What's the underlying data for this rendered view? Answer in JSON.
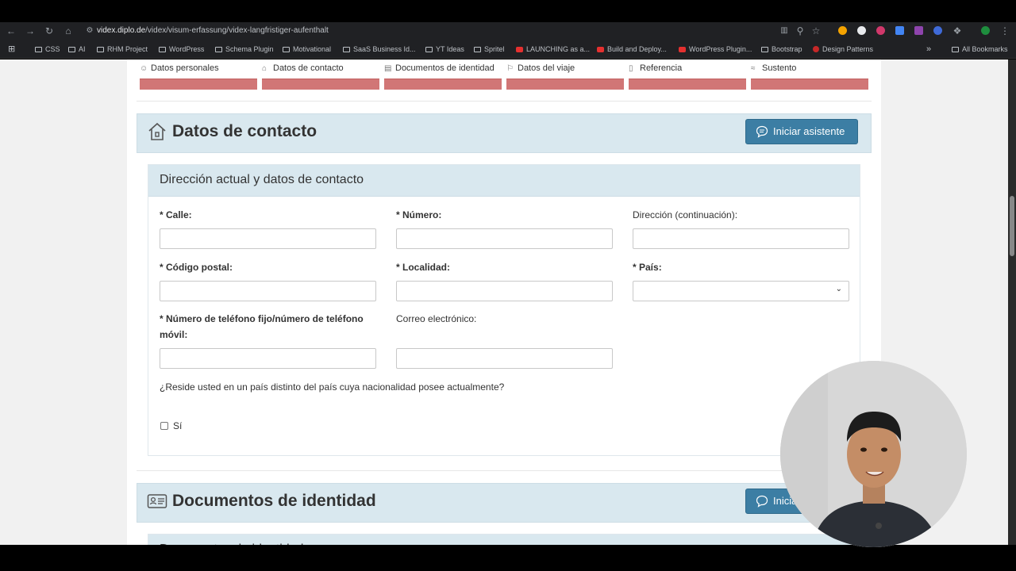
{
  "browser": {
    "url_domain": "videx.diplo.de",
    "url_path": "/videx/visum-erfassung/videx-langfristiger-aufenthalt"
  },
  "bookmarks": {
    "items": [
      "CSS",
      "AI",
      "RHM Project",
      "WordPress",
      "Schema Plugin",
      "Motivational",
      "SaaS Business Id...",
      "YT Ideas",
      "Spritel",
      "LAUNCHING as a...",
      "Build and Deploy...",
      "WordPress Plugin...",
      "Bootstrap",
      "Design Patterns"
    ],
    "more": "»",
    "all": "All Bookmarks"
  },
  "steps": [
    {
      "label": "Datos personales"
    },
    {
      "label": "Datos de contacto"
    },
    {
      "label": "Documentos de identidad"
    },
    {
      "label": "Datos del viaje"
    },
    {
      "label": "Referencia"
    },
    {
      "label": "Sustento"
    }
  ],
  "section_contact": {
    "title": "Datos de contacto",
    "assist_button": "Iniciar asistente"
  },
  "card": {
    "title": "Dirección actual y datos de contacto",
    "fields": {
      "calle": "* Calle:",
      "numero": "* Número:",
      "direccion2": "Dirección (continuación):",
      "codigo_postal": "* Código postal:",
      "localidad": "* Localidad:",
      "pais": "* País:",
      "telefono_line1": "* Número de teléfono fijo/número de teléfono",
      "telefono_line2": "móvil:",
      "correo": "Correo electrónico:"
    },
    "question": "¿Reside usted en un país distinto del país cuya nacionalidad posee actualmente?",
    "checkbox_label": "Sí"
  },
  "section_docs": {
    "title": "Documentos de identidad",
    "assist_button": "Inicia",
    "subcard_title": "Documentos de identidad"
  },
  "colors": {
    "accent": "#3c7ea4",
    "section_bg": "#d9e8ef",
    "step_bar": "#d17676"
  }
}
